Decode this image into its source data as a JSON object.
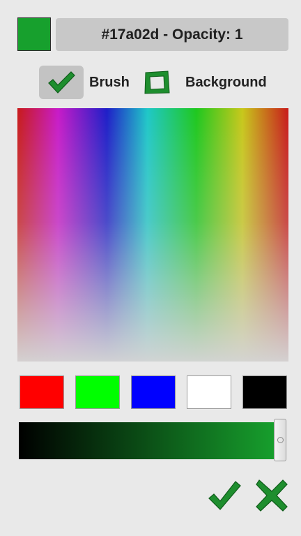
{
  "current_color": {
    "hex": "#17a02d",
    "opacity": 1,
    "readout": "#17a02d - Opacity: 1"
  },
  "targets": {
    "brush": {
      "label": "Brush",
      "selected": true,
      "icon": "checkmark-icon"
    },
    "background": {
      "label": "Background",
      "selected": false,
      "icon": "empty-square-icon"
    }
  },
  "spectrum": {
    "icon": "color-spectrum"
  },
  "presets": [
    {
      "name": "red",
      "color": "#ff0000"
    },
    {
      "name": "green",
      "color": "#00ff00"
    },
    {
      "name": "blue",
      "color": "#0000ff"
    },
    {
      "name": "white",
      "color": "#ffffff"
    },
    {
      "name": "black",
      "color": "#000000"
    }
  ],
  "brightness": {
    "value": 1.0,
    "from_color": "#000000",
    "to_color": "#17a02d"
  },
  "actions": {
    "confirm_icon": "checkmark-icon",
    "cancel_icon": "cross-icon",
    "accent_color": "#1f8f2f"
  }
}
